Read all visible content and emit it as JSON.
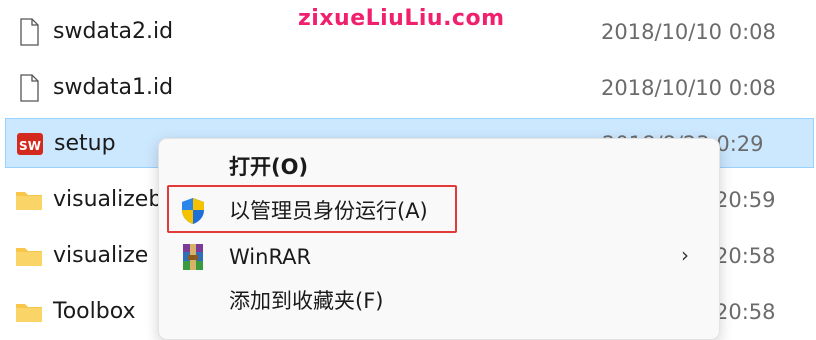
{
  "watermark": "zixueLiuLiu.com",
  "files": [
    {
      "name": "swdata2.id",
      "date": "2018/10/10 0:08",
      "icon": "file-icon"
    },
    {
      "name": "swdata1.id",
      "date": "2018/10/10 0:08",
      "icon": "file-icon"
    },
    {
      "name": "setup",
      "date": "2018/8/23 0:29",
      "icon": "solidworks-app-icon"
    },
    {
      "name": "visualizeb",
      "date": "20:59",
      "icon": "folder-icon"
    },
    {
      "name": "visualize",
      "date": "20:58",
      "icon": "folder-icon"
    },
    {
      "name": "Toolbox",
      "date": "20:58",
      "icon": "folder-icon"
    }
  ],
  "context_menu": {
    "items": [
      {
        "label": "打开(O)",
        "bold": true,
        "icon": ""
      },
      {
        "label": "以管理员身份运行(A)",
        "bold": false,
        "icon": "uac-shield-icon"
      },
      {
        "label": "WinRAR",
        "bold": false,
        "icon": "winrar-icon",
        "submenu": true
      },
      {
        "label": "添加到收藏夹(F)",
        "bold": false,
        "icon": ""
      }
    ]
  },
  "colors": {
    "selection": "#cce8ff",
    "highlight_box": "#e23a3a",
    "watermark": "#f0206e"
  }
}
